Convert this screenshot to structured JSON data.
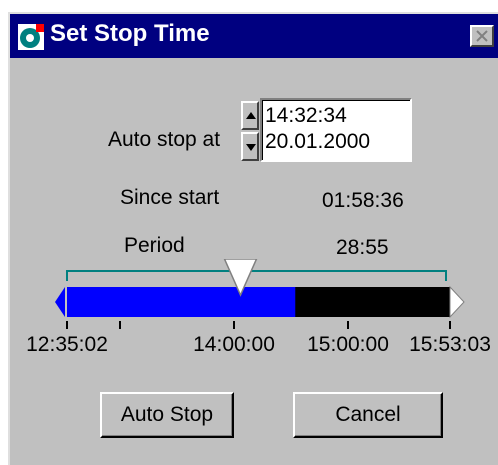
{
  "window": {
    "title": "Set Stop Time"
  },
  "auto_stop": {
    "label": "Auto stop at",
    "time": "14:32:34",
    "date": "20.01.2000"
  },
  "since_start": {
    "label": "Since start",
    "value": "01:58:36"
  },
  "period": {
    "label": "Period",
    "value": "28:55"
  },
  "timeline": {
    "ticks": [
      "12:35:02",
      "14:00:00",
      "15:00:00",
      "15:53:03"
    ],
    "progress_fraction": 0.596,
    "stop_marker_fraction": 0.453,
    "colors": {
      "elapsed": "#0000ff",
      "remaining": "#000000",
      "line": "#008080",
      "arrow": "#0000ff"
    }
  },
  "buttons": {
    "auto_stop": "Auto Stop",
    "cancel": "Cancel"
  },
  "icons": {
    "app": "app-icon",
    "close": "close-icon",
    "spin_up": "arrow-up-icon",
    "spin_down": "arrow-down-icon"
  }
}
